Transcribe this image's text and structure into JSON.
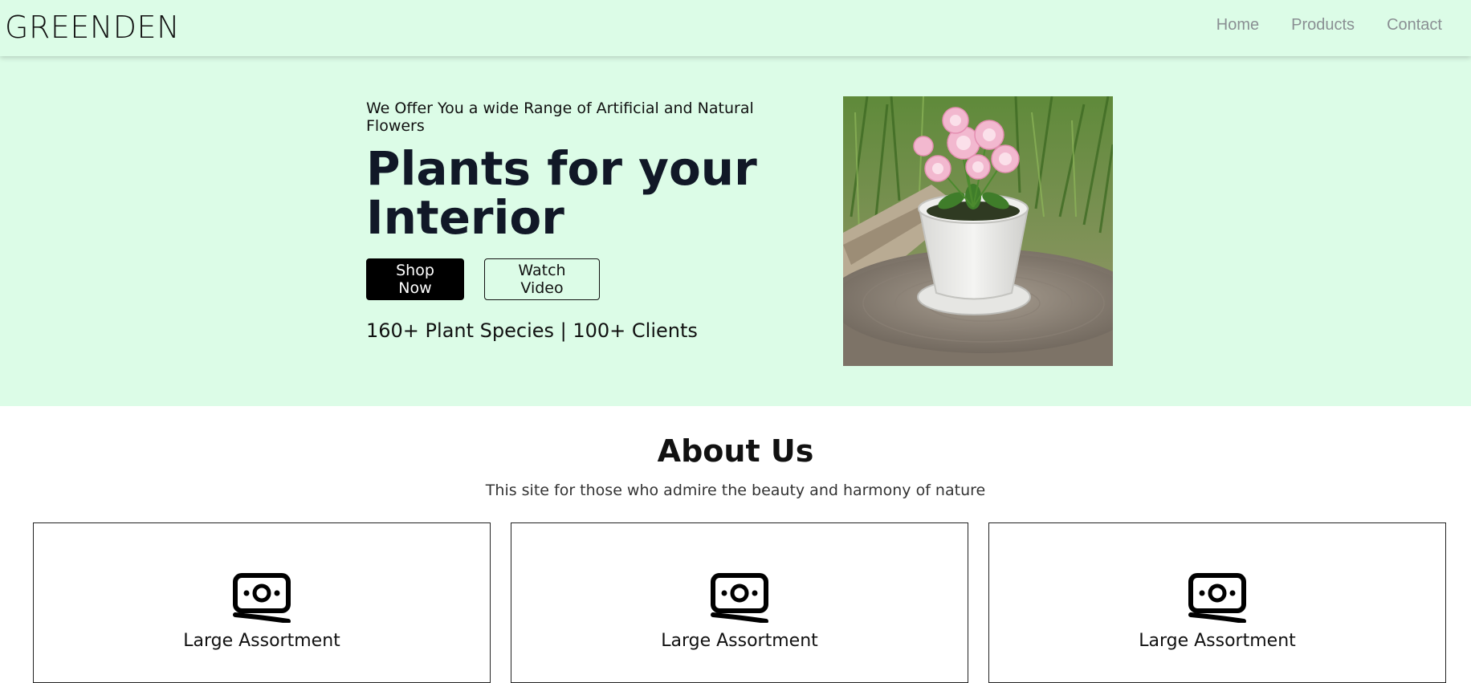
{
  "header": {
    "brand": "GREENDEN",
    "nav": [
      {
        "label": "Home"
      },
      {
        "label": "Products"
      },
      {
        "label": "Contact"
      }
    ]
  },
  "hero": {
    "tagline": "We Offer You a wide Range of Artificial and Natural Flowers",
    "headline_line1": "Plants for your",
    "headline_line2": "Interior",
    "primary_button": "Shop Now",
    "secondary_button": "Watch Video",
    "stats": "160+ Plant Species | 100+ Clients",
    "image_icon": "potted-flower-photo"
  },
  "about": {
    "title": "About Us",
    "subtitle": "This site for those who admire the beauty and harmony of nature",
    "cards": [
      {
        "icon": "money-icon",
        "title": "Large Assortment"
      },
      {
        "icon": "money-icon",
        "title": "Large Assortment"
      },
      {
        "icon": "money-icon",
        "title": "Large Assortment"
      }
    ]
  },
  "colors": {
    "mint_background": "#dcfce7",
    "headline": "#111827",
    "nav_link": "#8a8f93",
    "primary_button": "#000000"
  }
}
